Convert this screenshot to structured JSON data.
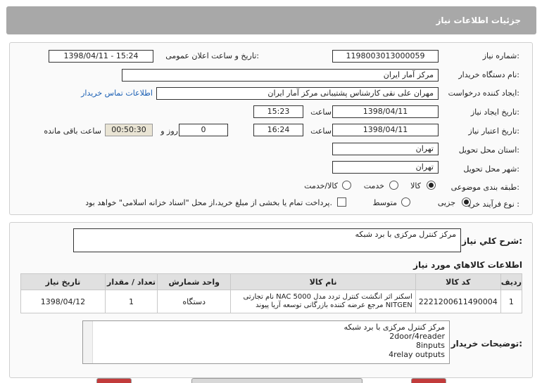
{
  "header": {
    "title": "جزئیات اطلاعات نیاز"
  },
  "form": {
    "need_number_label": "شماره نیاز:",
    "need_number": "1198003013000059",
    "announce_label": "تاریخ و ساعت اعلان عمومی:",
    "announce_value": "1398/04/11 - 15:24",
    "buyer_label": "نام دستگاه خریدار:",
    "buyer_value": "مرکز آمار ایران",
    "creator_label": "ایجاد کننده درخواست:",
    "creator_value": "مهران  علی نقی کارشناس پشتیبانی مرکز آمار ایران",
    "contact_link": "اطلاعات تماس خریدار",
    "created_label": "تاریخ ایجاد نیاز:",
    "created_date": "1398/04/11",
    "time_word": "ساعت",
    "created_time": "15:23",
    "validity_label": "تاریخ اعتبار نیاز:",
    "validity_date": "1398/04/11",
    "validity_time": "16:24",
    "days_value": "0",
    "days_word": "روز و",
    "remaining_value": "00:50:30",
    "remaining_word": "ساعت باقی مانده",
    "province_label": "استان محل تحویل:",
    "province_value": "تهران",
    "city_label": "شهر محل تحویل:",
    "city_value": "تهران",
    "category_label": "طبقه بندی موضوعی:",
    "category_options": [
      "کالا",
      "خدمت",
      "کالا/خدمت"
    ],
    "category_selected": 0,
    "process_label": "نوع فرآیند خرید :",
    "process_options": [
      "جزیی",
      "متوسط"
    ],
    "process_selected": 0,
    "payment_text": "پرداخت تمام یا بخشی از مبلغ خرید،از محل \"اسناد خزانه اسلامی\" خواهد بود."
  },
  "summary": {
    "label": "شرح كلي نياز:",
    "value": "مرکز کنترل مرکزی با برد شبکه"
  },
  "items": {
    "title": "اطلاعات كالاهاي مورد نياز",
    "columns": [
      "ردیف",
      "کد کالا",
      "نام کالا",
      "واحد شمارش",
      "تعداد / مقدار",
      "تاریخ نیاز"
    ],
    "rows": [
      {
        "index": "1",
        "code": "2221200611490004",
        "name": "اسکنر اثر انگشت کنترل تردد مدل NAC 5000 نام تجارتی NITGEN مرجع عرضه کننده بازرگانی توسعه آریا پیوند",
        "unit": "دستگاه",
        "qty": "1",
        "date": "1398/04/12"
      }
    ]
  },
  "buyer_notes": {
    "label": "توضیحات خریدار:",
    "lines": [
      "مرکز کنترل مرکزی با برد شبکه",
      "2door/4reader",
      "8inputs",
      "4relay outputs"
    ]
  }
}
